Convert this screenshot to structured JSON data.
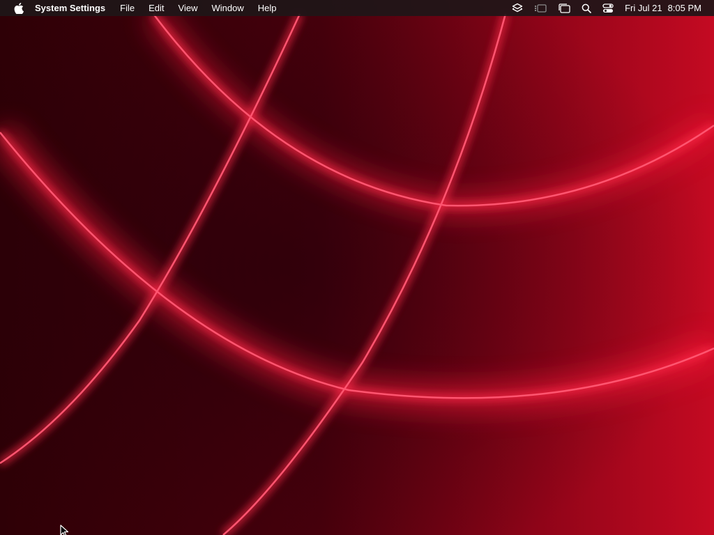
{
  "menubar": {
    "apple_icon": "apple-logo-icon",
    "app_name": "System Settings",
    "menus": [
      "File",
      "Edit",
      "View",
      "Window",
      "Help"
    ],
    "status_icons": [
      "shortcuts-icon",
      "stage-manager-icon",
      "window-switcher-icon",
      "search-icon",
      "control-center-icon"
    ],
    "date": "Fri Jul 21",
    "time": "8:05 PM"
  },
  "wallpaper": {
    "name": "red-curves-wallpaper",
    "base_color": "#5a0010",
    "accent_color": "#ff2a4a"
  },
  "cursor": {
    "icon": "arrow-cursor-icon"
  }
}
